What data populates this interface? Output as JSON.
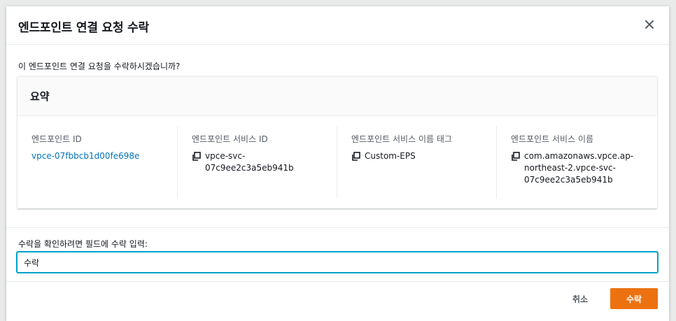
{
  "modal": {
    "title": "엔드포인트 연결 요청 수락",
    "close_icon": "close-icon",
    "question": "이 엔드포인트 연결 요청을 수락하시겠습니까?"
  },
  "summary": {
    "title": "요약",
    "columns": [
      {
        "label": "엔드포인트 ID",
        "value": "vpce-07fbbcb1d00fe698e",
        "style": "link",
        "copy_icon": false
      },
      {
        "label": "엔드포인트 서비스 ID",
        "value": "vpce-svc-07c9ee2c3a5eb941b",
        "style": "text",
        "copy_icon": true
      },
      {
        "label": "엔드포인트 서비스 이름 태그",
        "value": "Custom-EPS",
        "style": "text",
        "copy_icon": true
      },
      {
        "label": "엔드포인트 서비스 이름",
        "value": "com.amazonaws.vpce.ap-northeast-2.vpce-svc-07c9ee2c3a5eb941b",
        "style": "text",
        "copy_icon": true
      }
    ]
  },
  "confirm": {
    "label": "수락을 확인하려면 필드에 수락 입력:",
    "value": "수락"
  },
  "footer": {
    "cancel_label": "취소",
    "accept_label": "수락"
  },
  "colors": {
    "accent": "#ec7211",
    "link": "#0073bb",
    "focus": "#00a1c9"
  }
}
